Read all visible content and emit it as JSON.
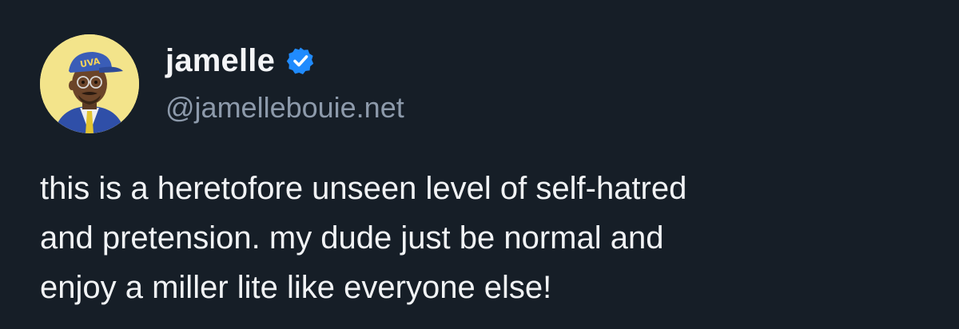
{
  "author": {
    "display_name": "jamelle",
    "handle": "@jamellebouie.net",
    "verified": true,
    "avatar_icon": "cartoon-avatar-uva-cap"
  },
  "avatar_cap_text": "UVA",
  "post": {
    "lines": [
      "this is a heretofore unseen level of self-hatred",
      "and pretension. my dude just be normal and",
      "enjoy a miller lite like everyone else!"
    ]
  },
  "colors": {
    "background": "#161e27",
    "text": "#f1f3f5",
    "handle": "#8d9aab",
    "verified_badge": "#208bfe",
    "avatar_bg": "#f3e48b"
  }
}
